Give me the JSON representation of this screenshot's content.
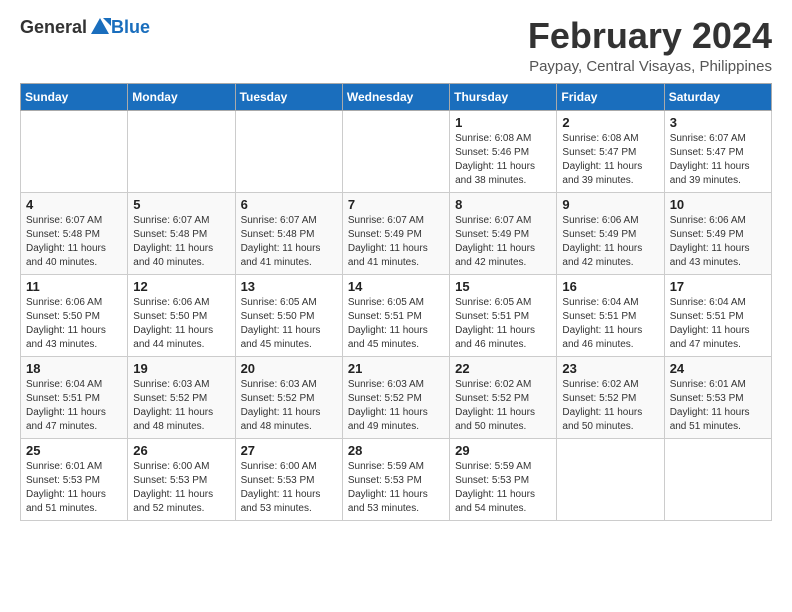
{
  "header": {
    "logo_general": "General",
    "logo_blue": "Blue",
    "month_year": "February 2024",
    "location": "Paypay, Central Visayas, Philippines"
  },
  "weekdays": [
    "Sunday",
    "Monday",
    "Tuesday",
    "Wednesday",
    "Thursday",
    "Friday",
    "Saturday"
  ],
  "weeks": [
    [
      {
        "day": "",
        "sunrise": "",
        "sunset": "",
        "daylight": ""
      },
      {
        "day": "",
        "sunrise": "",
        "sunset": "",
        "daylight": ""
      },
      {
        "day": "",
        "sunrise": "",
        "sunset": "",
        "daylight": ""
      },
      {
        "day": "",
        "sunrise": "",
        "sunset": "",
        "daylight": ""
      },
      {
        "day": "1",
        "sunrise": "Sunrise: 6:08 AM",
        "sunset": "Sunset: 5:46 PM",
        "daylight": "Daylight: 11 hours and 38 minutes."
      },
      {
        "day": "2",
        "sunrise": "Sunrise: 6:08 AM",
        "sunset": "Sunset: 5:47 PM",
        "daylight": "Daylight: 11 hours and 39 minutes."
      },
      {
        "day": "3",
        "sunrise": "Sunrise: 6:07 AM",
        "sunset": "Sunset: 5:47 PM",
        "daylight": "Daylight: 11 hours and 39 minutes."
      }
    ],
    [
      {
        "day": "4",
        "sunrise": "Sunrise: 6:07 AM",
        "sunset": "Sunset: 5:48 PM",
        "daylight": "Daylight: 11 hours and 40 minutes."
      },
      {
        "day": "5",
        "sunrise": "Sunrise: 6:07 AM",
        "sunset": "Sunset: 5:48 PM",
        "daylight": "Daylight: 11 hours and 40 minutes."
      },
      {
        "day": "6",
        "sunrise": "Sunrise: 6:07 AM",
        "sunset": "Sunset: 5:48 PM",
        "daylight": "Daylight: 11 hours and 41 minutes."
      },
      {
        "day": "7",
        "sunrise": "Sunrise: 6:07 AM",
        "sunset": "Sunset: 5:49 PM",
        "daylight": "Daylight: 11 hours and 41 minutes."
      },
      {
        "day": "8",
        "sunrise": "Sunrise: 6:07 AM",
        "sunset": "Sunset: 5:49 PM",
        "daylight": "Daylight: 11 hours and 42 minutes."
      },
      {
        "day": "9",
        "sunrise": "Sunrise: 6:06 AM",
        "sunset": "Sunset: 5:49 PM",
        "daylight": "Daylight: 11 hours and 42 minutes."
      },
      {
        "day": "10",
        "sunrise": "Sunrise: 6:06 AM",
        "sunset": "Sunset: 5:49 PM",
        "daylight": "Daylight: 11 hours and 43 minutes."
      }
    ],
    [
      {
        "day": "11",
        "sunrise": "Sunrise: 6:06 AM",
        "sunset": "Sunset: 5:50 PM",
        "daylight": "Daylight: 11 hours and 43 minutes."
      },
      {
        "day": "12",
        "sunrise": "Sunrise: 6:06 AM",
        "sunset": "Sunset: 5:50 PM",
        "daylight": "Daylight: 11 hours and 44 minutes."
      },
      {
        "day": "13",
        "sunrise": "Sunrise: 6:05 AM",
        "sunset": "Sunset: 5:50 PM",
        "daylight": "Daylight: 11 hours and 45 minutes."
      },
      {
        "day": "14",
        "sunrise": "Sunrise: 6:05 AM",
        "sunset": "Sunset: 5:51 PM",
        "daylight": "Daylight: 11 hours and 45 minutes."
      },
      {
        "day": "15",
        "sunrise": "Sunrise: 6:05 AM",
        "sunset": "Sunset: 5:51 PM",
        "daylight": "Daylight: 11 hours and 46 minutes."
      },
      {
        "day": "16",
        "sunrise": "Sunrise: 6:04 AM",
        "sunset": "Sunset: 5:51 PM",
        "daylight": "Daylight: 11 hours and 46 minutes."
      },
      {
        "day": "17",
        "sunrise": "Sunrise: 6:04 AM",
        "sunset": "Sunset: 5:51 PM",
        "daylight": "Daylight: 11 hours and 47 minutes."
      }
    ],
    [
      {
        "day": "18",
        "sunrise": "Sunrise: 6:04 AM",
        "sunset": "Sunset: 5:51 PM",
        "daylight": "Daylight: 11 hours and 47 minutes."
      },
      {
        "day": "19",
        "sunrise": "Sunrise: 6:03 AM",
        "sunset": "Sunset: 5:52 PM",
        "daylight": "Daylight: 11 hours and 48 minutes."
      },
      {
        "day": "20",
        "sunrise": "Sunrise: 6:03 AM",
        "sunset": "Sunset: 5:52 PM",
        "daylight": "Daylight: 11 hours and 48 minutes."
      },
      {
        "day": "21",
        "sunrise": "Sunrise: 6:03 AM",
        "sunset": "Sunset: 5:52 PM",
        "daylight": "Daylight: 11 hours and 49 minutes."
      },
      {
        "day": "22",
        "sunrise": "Sunrise: 6:02 AM",
        "sunset": "Sunset: 5:52 PM",
        "daylight": "Daylight: 11 hours and 50 minutes."
      },
      {
        "day": "23",
        "sunrise": "Sunrise: 6:02 AM",
        "sunset": "Sunset: 5:52 PM",
        "daylight": "Daylight: 11 hours and 50 minutes."
      },
      {
        "day": "24",
        "sunrise": "Sunrise: 6:01 AM",
        "sunset": "Sunset: 5:53 PM",
        "daylight": "Daylight: 11 hours and 51 minutes."
      }
    ],
    [
      {
        "day": "25",
        "sunrise": "Sunrise: 6:01 AM",
        "sunset": "Sunset: 5:53 PM",
        "daylight": "Daylight: 11 hours and 51 minutes."
      },
      {
        "day": "26",
        "sunrise": "Sunrise: 6:00 AM",
        "sunset": "Sunset: 5:53 PM",
        "daylight": "Daylight: 11 hours and 52 minutes."
      },
      {
        "day": "27",
        "sunrise": "Sunrise: 6:00 AM",
        "sunset": "Sunset: 5:53 PM",
        "daylight": "Daylight: 11 hours and 53 minutes."
      },
      {
        "day": "28",
        "sunrise": "Sunrise: 5:59 AM",
        "sunset": "Sunset: 5:53 PM",
        "daylight": "Daylight: 11 hours and 53 minutes."
      },
      {
        "day": "29",
        "sunrise": "Sunrise: 5:59 AM",
        "sunset": "Sunset: 5:53 PM",
        "daylight": "Daylight: 11 hours and 54 minutes."
      },
      {
        "day": "",
        "sunrise": "",
        "sunset": "",
        "daylight": ""
      },
      {
        "day": "",
        "sunrise": "",
        "sunset": "",
        "daylight": ""
      }
    ]
  ]
}
